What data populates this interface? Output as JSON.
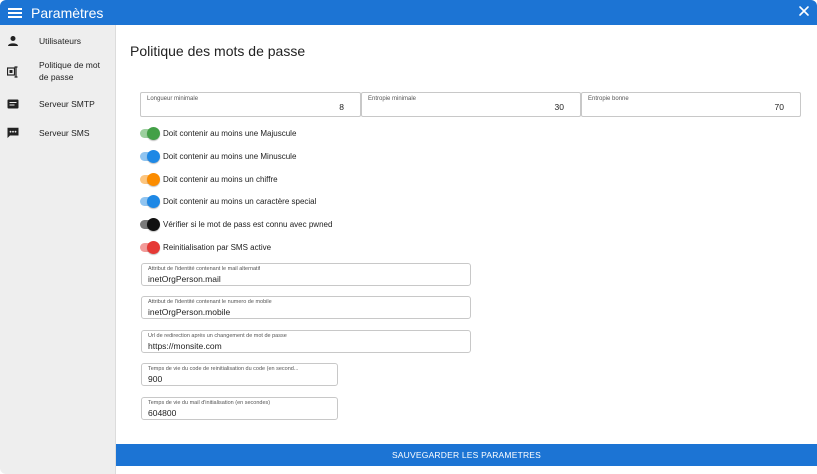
{
  "app": {
    "title": "Paramètres"
  },
  "sidebar": {
    "items": [
      {
        "label": "Utilisateurs",
        "icon": "person-icon"
      },
      {
        "label": "Politique de mot de passe",
        "icon": "password-policy-icon"
      },
      {
        "label": "Serveur SMTP",
        "icon": "mail-server-icon"
      },
      {
        "label": "Serveur SMS",
        "icon": "sms-icon"
      }
    ]
  },
  "main": {
    "title": "Politique des mots de passe",
    "numeric_fields": [
      {
        "label": "Longueur minimale",
        "value": "8"
      },
      {
        "label": "Entropie minimale",
        "value": "30"
      },
      {
        "label": "Entropie bonne",
        "value": "70"
      }
    ],
    "toggles": [
      {
        "label": "Doit contenir au moins une Majuscule",
        "color": "#43a047",
        "on": true
      },
      {
        "label": "Doit contenir au moins une Minuscule",
        "color": "#1e88e5",
        "on": true
      },
      {
        "label": "Doit contenir au moins un chiffre",
        "color": "#fb8c00",
        "on": true
      },
      {
        "label": "Doit contenir au moins un caractère special",
        "color": "#1e88e5",
        "on": true
      },
      {
        "label": "Vérifier si le mot de pass est connu avec pwned",
        "color": "#111111",
        "on": true
      },
      {
        "label": "Reinitialisation par SMS active",
        "color": "#e53935",
        "on": true
      }
    ],
    "text_fields": [
      {
        "label": "Attribut de l'identité contenant le mail alternatif",
        "value": "inetOrgPerson.mail"
      },
      {
        "label": "Attribut de l'identité contenant le numero de mobile",
        "value": "inetOrgPerson.mobile"
      },
      {
        "label": "Url de redirection après un changement de mot de passe",
        "value": "https://monsite.com"
      },
      {
        "label": "Temps de vie du code de reinitialisation du code (en second...",
        "value": "900"
      },
      {
        "label": "Temps de vie du mail d'initialisation (en secondes)",
        "value": "604800"
      }
    ],
    "save_label": "SAUVEGARDER LES PARAMETRES"
  },
  "colors": {
    "primary": "#1c74d4",
    "sidebar_bg": "#eeeeee"
  }
}
